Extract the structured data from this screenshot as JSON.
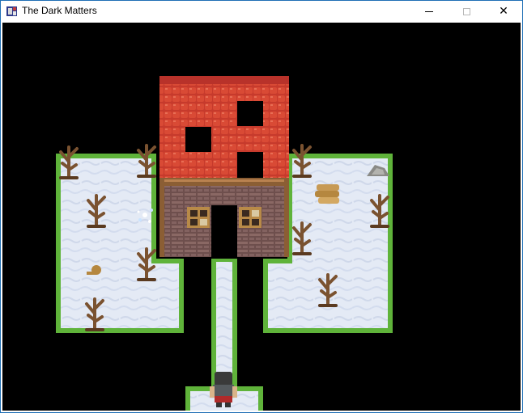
{
  "window": {
    "title": "The Dark Matters",
    "app_icon": "rpg-maker-icon",
    "controls": {
      "minimize_icon": "minimize-icon",
      "maximize_icon": "maximize-icon",
      "close_icon": "close-icon",
      "close_glyph": "✕"
    }
  },
  "scene": {
    "background_color": "#000000",
    "snow_color": "#e6ecf6",
    "grass_color": "#5fb33a",
    "roof_color": "#c0392b",
    "wall_color": "#7a5a55",
    "tree_color": "#7a5230",
    "objects": [
      "red-roof-house",
      "dead-trees",
      "log-pile",
      "rock",
      "sparkle",
      "player-character"
    ]
  }
}
